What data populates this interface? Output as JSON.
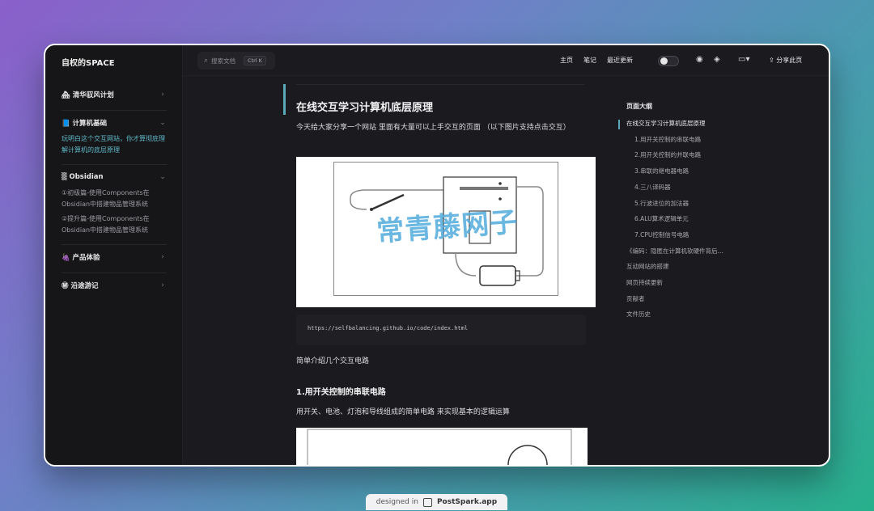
{
  "site": {
    "title": "自权的SPACE"
  },
  "sidebar": {
    "groups": [
      {
        "title": "🏘 清华驭风计划",
        "items": []
      },
      {
        "title": "📘 计算机基础",
        "items": [
          "玩明白这个交互网站，你才算彻底理解计算机的底层原理"
        ]
      },
      {
        "title": "▒ Obsidian",
        "items": [
          "①初级篇-使用Components在Obsidian中搭建物品管理系统",
          "②提升篇-使用Components在Obsidian中搭建物品管理系统"
        ]
      },
      {
        "title": "🍇 产品体验",
        "items": []
      },
      {
        "title": "㊙ 沿途游记",
        "items": []
      }
    ]
  },
  "topbar": {
    "search_placeholder": "搜索文档",
    "shortcut": "Ctrl K",
    "nav": [
      "主页",
      "笔记",
      "最近更新"
    ],
    "share_label": "分享此页"
  },
  "article": {
    "title": "在线交互学习计算机底层原理",
    "intro": "今天给大家分享一个网站 里面有大量可以上手交互的页面 （以下图片支持点击交互）",
    "watermark": "常青藤网子",
    "code_url": "https://selfbalancing.github.io/code/index.html",
    "para2": "简单介绍几个交互电路",
    "section1_title": "1.用开关控制的串联电路",
    "section1_text": "用开关、电池、灯泡和导线组成的简单电路 来实现基本的逻辑运算"
  },
  "outline": {
    "title": "页面大纲",
    "items": [
      {
        "label": "在线交互学习计算机底层原理",
        "level": 1,
        "active": true
      },
      {
        "label": "1.用开关控制的串联电路",
        "level": 2
      },
      {
        "label": "2.用开关控制的并联电路",
        "level": 2
      },
      {
        "label": "3.串联的继电器电路",
        "level": 2
      },
      {
        "label": "4.三八译码器",
        "level": 2
      },
      {
        "label": "5.行波进位的加法器",
        "level": 2
      },
      {
        "label": "6.ALU算术逻辑单元",
        "level": 2
      },
      {
        "label": "7.CPU控制信号电路",
        "level": 2
      },
      {
        "label": "《编码：隐匿在计算机软硬件背后的语言》",
        "level": 1
      },
      {
        "label": "互动网站的搭建",
        "level": 1
      },
      {
        "label": "网页持续更新",
        "level": 1
      },
      {
        "label": "贡献者",
        "level": 1
      },
      {
        "label": "文件历史",
        "level": 1
      }
    ]
  },
  "footer": {
    "designed_in": "designed in",
    "brand": "PostSpark.app"
  }
}
